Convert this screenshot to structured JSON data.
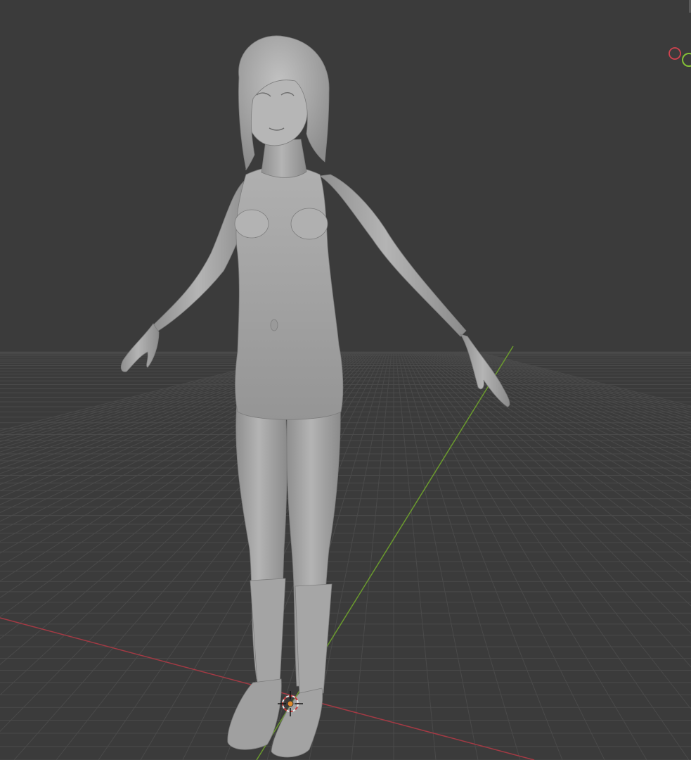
{
  "app": "3D viewport",
  "viewport": {
    "background": "#3b3b3b",
    "grid_color": "#4a4a4a",
    "x_axis_color": "#a33a44",
    "y_axis_color": "#6b9a2e",
    "shading": "solid",
    "gizmo": {
      "x_axis_color": "#d2434f",
      "y_axis_color": "#84c036"
    },
    "object": {
      "type": "figure mesh",
      "material_color": "#a9a9a9"
    },
    "cursor": {
      "icon": "3d-cursor-icon",
      "colors": [
        "#e8e8e8",
        "#c43b3b"
      ]
    }
  }
}
